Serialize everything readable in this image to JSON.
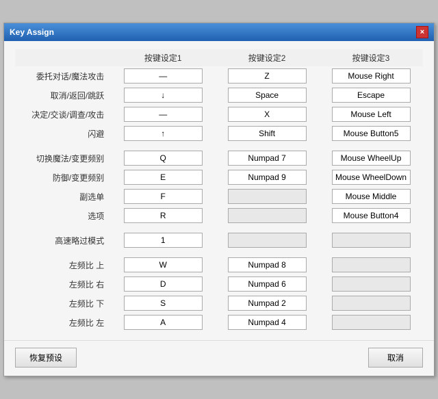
{
  "window": {
    "title": "Key Assign",
    "close_label": "×"
  },
  "table": {
    "headers": [
      "",
      "按键设定1",
      "按键设定2",
      "按键设定3"
    ],
    "rows": [
      {
        "label": "委托对话/魔法攻击",
        "key1": "—",
        "key2": "Z",
        "key3": "Mouse Right"
      },
      {
        "label": "取消/返回/跳跃",
        "key1": "↓",
        "key2": "Space",
        "key3": "Escape"
      },
      {
        "label": "决定/交谈/调查/攻击",
        "key1": "—",
        "key2": "X",
        "key3": "Mouse Left"
      },
      {
        "label": "闪避",
        "key1": "↑",
        "key2": "Shift",
        "key3": "Mouse Button5"
      },
      {
        "label": "切换魔法/变更频别",
        "key1": "Q",
        "key2": "Numpad 7",
        "key3": "Mouse WheelUp"
      },
      {
        "label": "防御/变更频别",
        "key1": "E",
        "key2": "Numpad 9",
        "key3": "Mouse WheelDown"
      },
      {
        "label": "副选单",
        "key1": "F",
        "key2": "",
        "key3": "Mouse Middle"
      },
      {
        "label": "选项",
        "key1": "R",
        "key2": "",
        "key3": "Mouse Button4"
      },
      {
        "label": "高速略过模式",
        "key1": "1",
        "key2": "",
        "key3": ""
      },
      {
        "label": "左频比 上",
        "key1": "W",
        "key2": "Numpad 8",
        "key3": ""
      },
      {
        "label": "左频比 右",
        "key1": "D",
        "key2": "Numpad 6",
        "key3": ""
      },
      {
        "label": "左频比 下",
        "key1": "S",
        "key2": "Numpad 2",
        "key3": ""
      },
      {
        "label": "左频比 左",
        "key1": "A",
        "key2": "Numpad 4",
        "key3": ""
      }
    ]
  },
  "footer": {
    "restore_label": "恢复预设",
    "cancel_label": "取消"
  }
}
